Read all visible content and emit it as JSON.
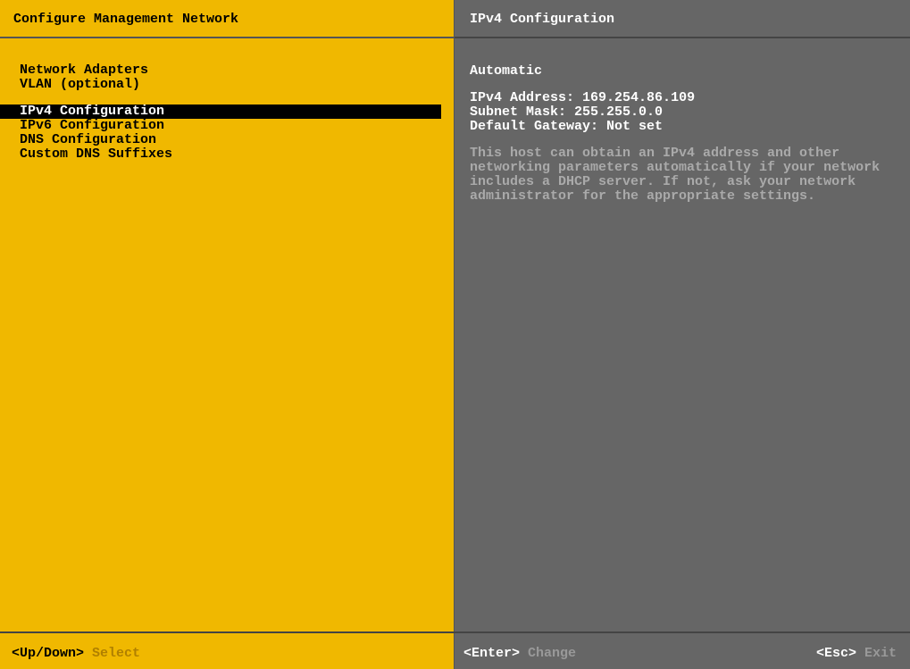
{
  "left": {
    "title": "Configure Management Network",
    "menu_group_1": [
      {
        "label": "Network Adapters"
      },
      {
        "label": "VLAN (optional)"
      }
    ],
    "menu_group_2": [
      {
        "label": "IPv4 Configuration",
        "selected": true
      },
      {
        "label": "IPv6 Configuration"
      },
      {
        "label": "DNS Configuration"
      },
      {
        "label": "Custom DNS Suffixes"
      }
    ]
  },
  "right": {
    "title": "IPv4 Configuration",
    "automatic": "Automatic",
    "ipv4_address_label": "IPv4 Address:",
    "ipv4_address_value": "169.254.86.109",
    "subnet_mask_label": "Subnet Mask:",
    "subnet_mask_value": "255.255.0.0",
    "default_gateway_label": "Default Gateway:",
    "default_gateway_value": "Not set",
    "help_text": "This host can obtain an IPv4 address and other networking parameters automatically if your network includes a DHCP server. If not, ask your network administrator for the appropriate settings."
  },
  "footer": {
    "left_key": "<Up/Down>",
    "left_action": "Select",
    "enter_key": "<Enter>",
    "enter_action": "Change",
    "esc_key": "<Esc>",
    "esc_action": "Exit"
  }
}
